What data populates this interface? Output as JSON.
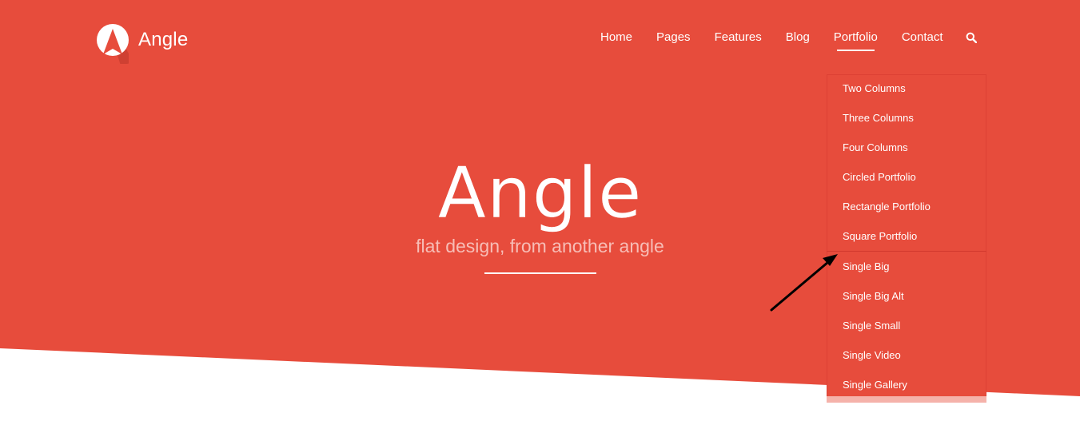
{
  "brand": {
    "name": "Angle"
  },
  "colors": {
    "primary": "#e74c3c",
    "text": "#ffffff",
    "subtitle": "#f7bdb6",
    "arrow": "#000000"
  },
  "nav": {
    "items": [
      {
        "label": "Home",
        "active": false
      },
      {
        "label": "Pages",
        "active": false
      },
      {
        "label": "Features",
        "active": false
      },
      {
        "label": "Blog",
        "active": false
      },
      {
        "label": "Portfolio",
        "active": true
      },
      {
        "label": "Contact",
        "active": false
      }
    ],
    "search_icon": "search-icon"
  },
  "dropdown": {
    "items": [
      "Two Columns",
      "Three Columns",
      "Four Columns",
      "Circled Portfolio",
      "Rectangle Portfolio",
      "Square Portfolio",
      "Single Big",
      "Single Big Alt",
      "Single Small",
      "Single Video",
      "Single Gallery"
    ]
  },
  "hero": {
    "title": "Angle",
    "subtitle": "flat design, from another angle"
  }
}
